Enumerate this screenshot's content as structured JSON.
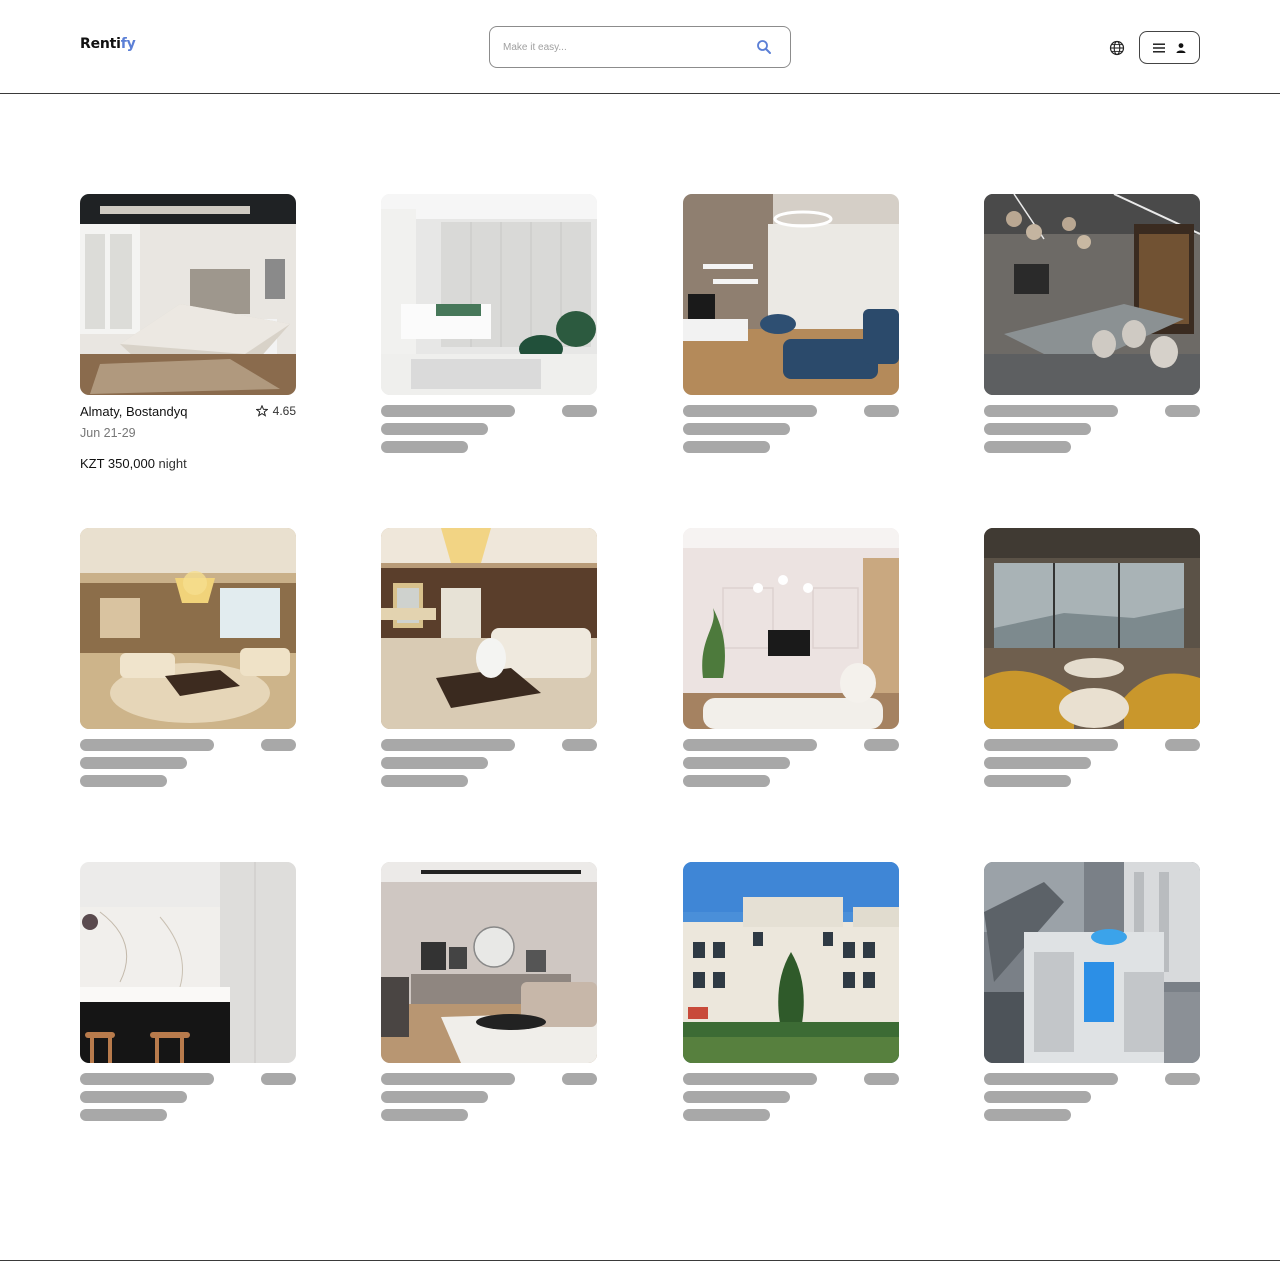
{
  "header": {
    "logo_main": "Renti",
    "logo_accent": "fy",
    "search_placeholder": "Make it easy...",
    "language_icon": "globe-icon",
    "menu_icon": "hamburger-icon",
    "profile_icon": "user-icon"
  },
  "listings": [
    {
      "photo": "bedroom",
      "loaded": true,
      "title": "Almaty, Bostandyq",
      "rating": "4.65",
      "dates": "Jun 21-29",
      "price": "KZT 350,000",
      "price_unit": "night"
    },
    {
      "photo": "bedroom-wardrobe",
      "loaded": false
    },
    {
      "photo": "living-room-blue-sofa",
      "loaded": false
    },
    {
      "photo": "dining-chandeliers",
      "loaded": false
    },
    {
      "photo": "grand-living-chandelier",
      "loaded": false
    },
    {
      "photo": "classic-living-mirror",
      "loaded": false
    },
    {
      "photo": "white-living-room",
      "loaded": false
    },
    {
      "photo": "panoramic-window-lounge",
      "loaded": false
    },
    {
      "photo": "marble-kitchen",
      "loaded": false
    },
    {
      "photo": "modern-living-sectional",
      "loaded": false
    },
    {
      "photo": "townhouse-exterior",
      "loaded": false
    },
    {
      "photo": "aerial-pool-complex",
      "loaded": false
    }
  ],
  "colors": {
    "logo_accent": "#5b7fd6",
    "skeleton": "#a8a8a8",
    "divider": "#3a3a3a"
  }
}
